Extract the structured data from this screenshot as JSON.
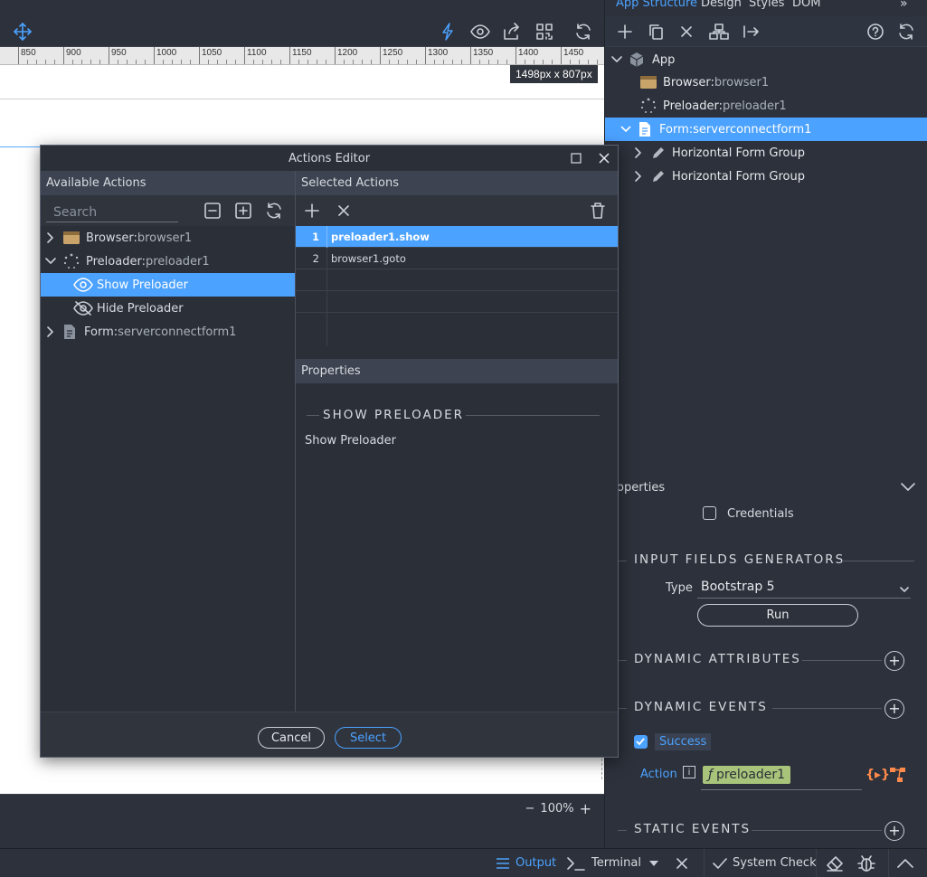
{
  "right_panel": {
    "tabs": [
      "App Structure",
      "Design",
      "Styles",
      "DOM"
    ],
    "tree": [
      {
        "kw": "App",
        "val": ""
      },
      {
        "kw": "Browser: ",
        "val": "browser1"
      },
      {
        "kw": "Preloader: ",
        "val": "preloader1"
      },
      {
        "kw": "Form: ",
        "val": "serverconnectform1"
      },
      {
        "kw": "Horizontal Form Group",
        "val": ""
      },
      {
        "kw": "Horizontal Form Group",
        "val": ""
      }
    ],
    "properties_title": "roperties",
    "credentials_label": "Credentials",
    "input_fields_title": "INPUT FIELDS GENERATORS",
    "type_label": "Type",
    "type_value": "Bootstrap 5",
    "run_label": "Run",
    "dynamic_attributes_title": "DYNAMIC ATTRIBUTES",
    "dynamic_events_title": "DYNAMIC EVENTS",
    "success_label": "Success",
    "action_label": "Action",
    "action_value": "preloader1",
    "static_events_title": "STATIC EVENTS"
  },
  "design": {
    "ruler_labels": [
      "850",
      "900",
      "950",
      "1000",
      "1050",
      "1100",
      "1150",
      "1200",
      "1250",
      "1300",
      "1350",
      "1400",
      "1450"
    ],
    "size_badge": "1498px x 807px",
    "zoom": "100%"
  },
  "dialog": {
    "title": "Actions Editor",
    "available_title": "Available Actions",
    "selected_title": "Selected Actions",
    "search_placeholder": "Search",
    "available_items": [
      {
        "kw": "Browser: ",
        "val": "browser1"
      },
      {
        "kw": "Preloader: ",
        "val": "preloader1"
      },
      {
        "kw": "Show Preloader",
        "val": ""
      },
      {
        "kw": "Hide Preloader",
        "val": ""
      },
      {
        "kw": "Form: ",
        "val": "serverconnectform1"
      }
    ],
    "selected_rows": [
      {
        "num": "1",
        "action": "preloader1.show"
      },
      {
        "num": "2",
        "action": "browser1.goto"
      }
    ],
    "properties_title": "Properties",
    "section_title": "SHOW PRELOADER",
    "section_desc": "Show Preloader",
    "cancel_label": "Cancel",
    "select_label": "Select"
  },
  "statusbar": {
    "output_label": "Output",
    "terminal_label": "Terminal",
    "system_check_label": "System Check"
  },
  "colors": {
    "accent": "#4ca2ff",
    "background": "#2c313b",
    "action_chip": "#a8c47a"
  }
}
